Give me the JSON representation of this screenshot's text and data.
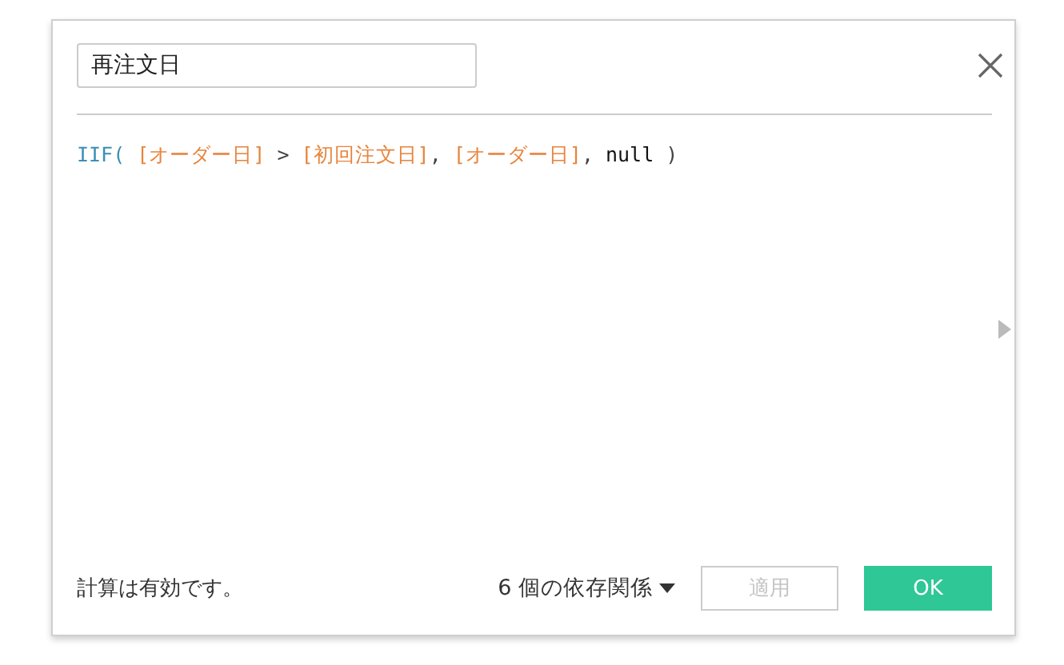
{
  "dialog": {
    "name_field": {
      "value": "再注文日"
    },
    "formula": [
      {
        "kind": "function",
        "text": "IIF("
      },
      {
        "kind": "field",
        "text": " [オーダー日]"
      },
      {
        "kind": "operator",
        "text": " >"
      },
      {
        "kind": "field",
        "text": " [初回注文日]"
      },
      {
        "kind": "operator",
        "text": ","
      },
      {
        "kind": "field",
        "text": " [オーダー日]"
      },
      {
        "kind": "operator",
        "text": ","
      },
      {
        "kind": "keyword",
        "text": " null"
      },
      {
        "kind": "operator",
        "text": " )"
      }
    ],
    "status": "計算は有効です。",
    "dependencies": "6 個の依存関係",
    "buttons": [
      {
        "label": "適用",
        "disabled": true,
        "primary": false
      },
      {
        "label": "OK",
        "disabled": false,
        "primary": true
      }
    ]
  }
}
